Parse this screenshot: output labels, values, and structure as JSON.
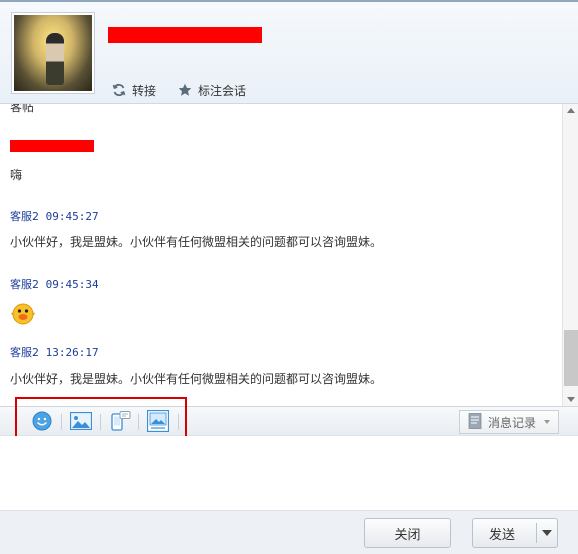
{
  "header": {
    "contact_name_tail": "",
    "actions": {
      "transfer_label": "转接",
      "mark_label": "标注会话"
    }
  },
  "chat": {
    "previous_text": "客帖",
    "messages": [
      {
        "sender": "",
        "time": "",
        "text": "嗨"
      },
      {
        "sender": "客服2",
        "time": "09:45:27",
        "text": "小伙伴好，我是盟妹。小伙伴有任何微盟相关的问题都可以咨询盟妹。"
      },
      {
        "sender": "客服2",
        "time": "09:45:34",
        "text": ""
      },
      {
        "sender": "客服2",
        "time": "13:26:17",
        "text": "小伙伴好，我是盟妹。小伙伴有任何微盟相关的问题都可以咨询盟妹。"
      }
    ]
  },
  "toolbar": {
    "tools": [
      "smiley-icon",
      "image-icon",
      "mobile-icon",
      "screenshot-icon"
    ],
    "history_label": "消息记录"
  },
  "input": {
    "value": "",
    "placeholder": ""
  },
  "footer": {
    "close_label": "关闭",
    "send_label": "发送"
  },
  "colors": {
    "sender": "#1c3d9c",
    "redaction": "#ff0000",
    "highlight": "#d60000",
    "icon_blue": "#3b8fd8"
  }
}
